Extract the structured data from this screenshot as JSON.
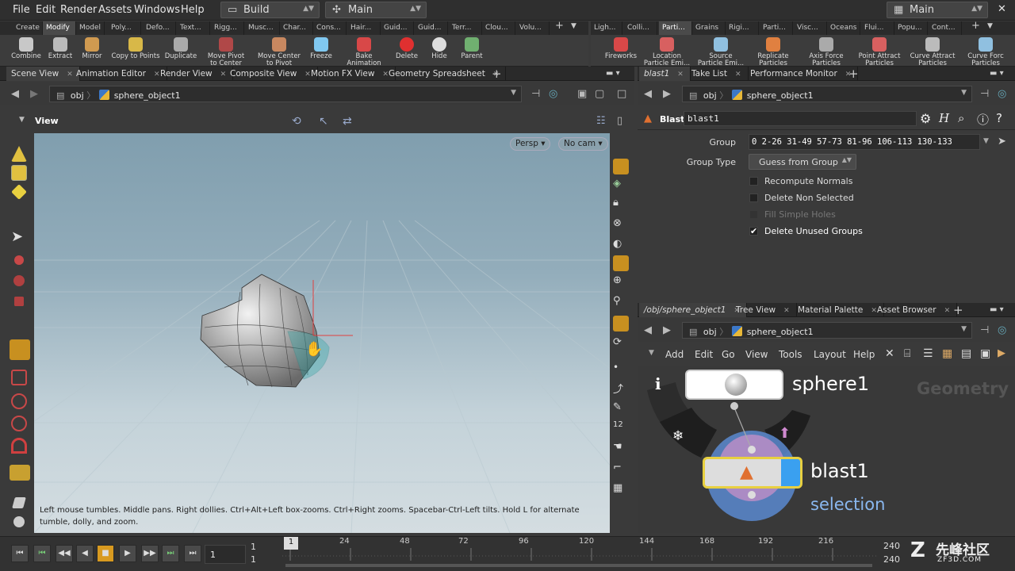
{
  "menubar": {
    "items": [
      "File",
      "Edit",
      "Render",
      "Assets",
      "Windows",
      "Help"
    ],
    "desktop": "Build",
    "network": "Main",
    "right_desktop": "Main"
  },
  "shelf": {
    "tabs_left": [
      "Create",
      "Modify",
      "Model",
      "Poly...",
      "Defo...",
      "Text...",
      "Rigg...",
      "Musc...",
      "Char...",
      "Cons...",
      "Hair...",
      "Guid...",
      "Guid...",
      "Terr...",
      "Clou...",
      "Volu..."
    ],
    "tabs_right": [
      "Ligh...",
      "Colli...",
      "Parti...",
      "Grains",
      "Rigi...",
      "Parti...",
      "Visc...",
      "Oceans",
      "Flui...",
      "Popu...",
      "Cont..."
    ],
    "tools_left": [
      {
        "l1": "Combine",
        "l2": ""
      },
      {
        "l1": "Extract",
        "l2": ""
      },
      {
        "l1": "Mirror",
        "l2": ""
      },
      {
        "l1": "Copy to Points",
        "l2": ""
      },
      {
        "l1": "Duplicate",
        "l2": ""
      },
      {
        "l1": "Move Pivot",
        "l2": "to Center"
      },
      {
        "l1": "Move Center",
        "l2": "to Pivot"
      },
      {
        "l1": "Freeze",
        "l2": ""
      },
      {
        "l1": "Bake",
        "l2": "Animation"
      },
      {
        "l1": "Delete",
        "l2": ""
      },
      {
        "l1": "Hide",
        "l2": ""
      },
      {
        "l1": "Parent",
        "l2": ""
      }
    ],
    "tools_right": [
      {
        "l1": "Fireworks",
        "l2": ""
      },
      {
        "l1": "Location",
        "l2": "Particle Emi..."
      },
      {
        "l1": "Source",
        "l2": "Particle Emi..."
      },
      {
        "l1": "Replicate",
        "l2": "Particles"
      },
      {
        "l1": "Axis Force",
        "l2": "Particles"
      },
      {
        "l1": "Point Attract",
        "l2": "Particles"
      },
      {
        "l1": "Curve Attract",
        "l2": "Particles"
      },
      {
        "l1": "Curve Forc",
        "l2": "Particles"
      }
    ]
  },
  "scene_panel": {
    "tabs": [
      "Scene View",
      "Animation Editor",
      "Render View",
      "Composite View",
      "Motion FX View",
      "Geometry Spreadsheet"
    ],
    "path_root": "obj",
    "path_node": "sphere_object1",
    "view_label": "View",
    "persp": "Persp",
    "cam": "No cam",
    "status": "Left mouse tumbles. Middle pans. Right dollies. Ctrl+Alt+Left box-zooms. Ctrl+Right zooms. Spacebar-Ctrl-Left tilts. Hold L for alternate tumble, dolly, and zoom."
  },
  "param_panel": {
    "tabs": [
      "blast1",
      "Take List",
      "Performance Monitor"
    ],
    "path_root": "obj",
    "path_node": "sphere_object1",
    "node_type": "Blast",
    "node_name": "blast1",
    "group_label": "Group",
    "group_value": "0 2-26 31-49 57-73 81-96 106-113 130-133",
    "group_type_label": "Group Type",
    "group_type_value": "Guess from Group",
    "checkboxes": [
      {
        "label": "Recompute Normals",
        "checked": false
      },
      {
        "label": "Delete Non Selected",
        "checked": false
      },
      {
        "label": "Fill Simple Holes",
        "checked": false
      },
      {
        "label": "Delete Unused Groups",
        "checked": true
      }
    ]
  },
  "network_panel": {
    "tabs": [
      "/obj/sphere_object1",
      "Tree View",
      "Material Palette",
      "Asset Browser"
    ],
    "path_root": "obj",
    "path_node": "sphere_object1",
    "menu": [
      "Add",
      "Edit",
      "Go",
      "View",
      "Tools",
      "Layout",
      "Help"
    ],
    "context": "Geometry",
    "node1": "sphere1",
    "node2": "blast1",
    "node2_sub": "selection",
    "info": "i"
  },
  "timeline": {
    "current": "1",
    "start": "1",
    "start2": "1",
    "end": "240",
    "end2": "240",
    "frame_box": "1",
    "ticks": [
      "24",
      "48",
      "72",
      "96",
      "120",
      "144",
      "168",
      "192",
      "216"
    ]
  },
  "watermark": {
    "cn": "先峰社区",
    "url": "ZF3D.COM"
  }
}
